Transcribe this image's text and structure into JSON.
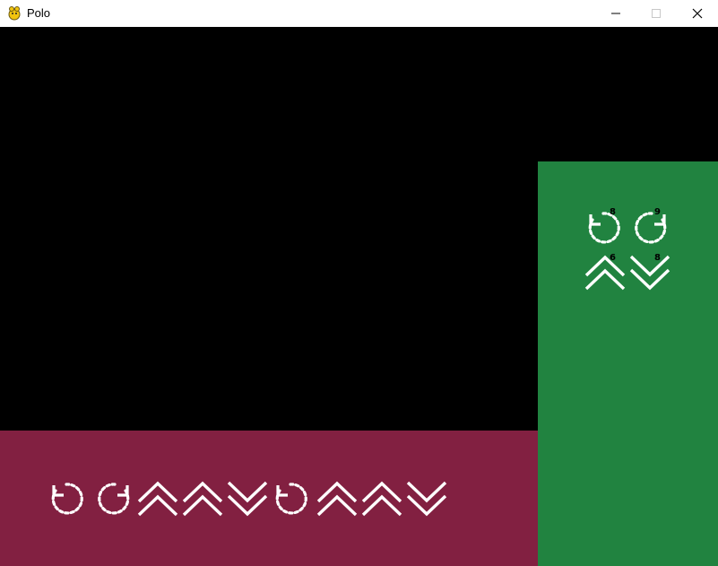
{
  "window": {
    "title": "Polo",
    "icon": "pygame-snake-icon",
    "controls": [
      "minimize-icon",
      "maximize-icon",
      "close-icon"
    ]
  },
  "colors": {
    "board": "#000000",
    "player_tray": "#822041",
    "side_tray": "#218340",
    "card_stroke": "#ffffff"
  },
  "player_hand": {
    "cards": [
      {
        "icon": "rotate-left-icon"
      },
      {
        "icon": "rotate-right-icon"
      },
      {
        "icon": "move-forward-icon"
      },
      {
        "icon": "move-forward-icon"
      },
      {
        "icon": "move-back-icon"
      },
      {
        "icon": "rotate-left-icon"
      },
      {
        "icon": "move-forward-icon"
      },
      {
        "icon": "move-forward-icon"
      },
      {
        "icon": "move-back-icon"
      }
    ]
  },
  "deck": {
    "cards": [
      {
        "icon": "rotate-left-icon",
        "count": "8"
      },
      {
        "icon": "rotate-right-icon",
        "count": "9"
      },
      {
        "icon": "move-forward-icon",
        "count": "6"
      },
      {
        "icon": "move-back-icon",
        "count": "8"
      }
    ]
  }
}
